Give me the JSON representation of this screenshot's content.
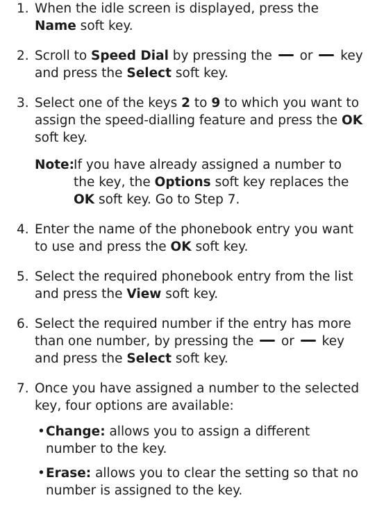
{
  "steps": [
    {
      "num": "1.",
      "t1": "When the idle screen is displayed, press the ",
      "b1": "Name",
      "t2": " soft key."
    },
    {
      "num": "2.",
      "t1": "Scroll to ",
      "b1": "Speed Dial",
      "t2": " by pressing the ",
      "t3": " or ",
      "t4": " key and press the ",
      "b2": "Select",
      "t5": " soft key."
    },
    {
      "num": "3.",
      "t1": "Select one of the keys ",
      "b1": "2",
      "t2": " to ",
      "b2": "9",
      "t3": " to which you want to assign the speed-dialling feature and press the ",
      "b3": "OK",
      "t4": " soft key."
    },
    {
      "num": "4.",
      "t1": "Enter the name of the phonebook entry you want to use and press the ",
      "b1": "OK",
      "t2": " soft key."
    },
    {
      "num": "5.",
      "t1": "Select the required phonebook entry from the list and press the ",
      "b1": "View",
      "t2": " soft key."
    },
    {
      "num": "6.",
      "t1": "Select the required number if the entry has more than one number, by pressing the ",
      "t2": " or ",
      "t3": " key and press the ",
      "b1": "Select",
      "t4": " soft key."
    },
    {
      "num": "7.",
      "t1": "Once you have assigned a number to the selected key, four options are available:"
    }
  ],
  "note": {
    "label": "Note:",
    "t1": "If you have already assigned a number to the key, the ",
    "b1": "Options",
    "t2": " soft key replaces the ",
    "b2": "OK",
    "t3": " soft key. Go to Step 7."
  },
  "options": [
    {
      "bullet": "•",
      "label": "Change:",
      "text": " allows you to assign a different number to the key."
    },
    {
      "bullet": "•",
      "label": "Erase:",
      "text": " allows you to clear the setting so that no number is assigned to the key."
    }
  ],
  "icons": {
    "up_key": "nav-up-key-icon",
    "down_key": "nav-down-key-icon"
  }
}
